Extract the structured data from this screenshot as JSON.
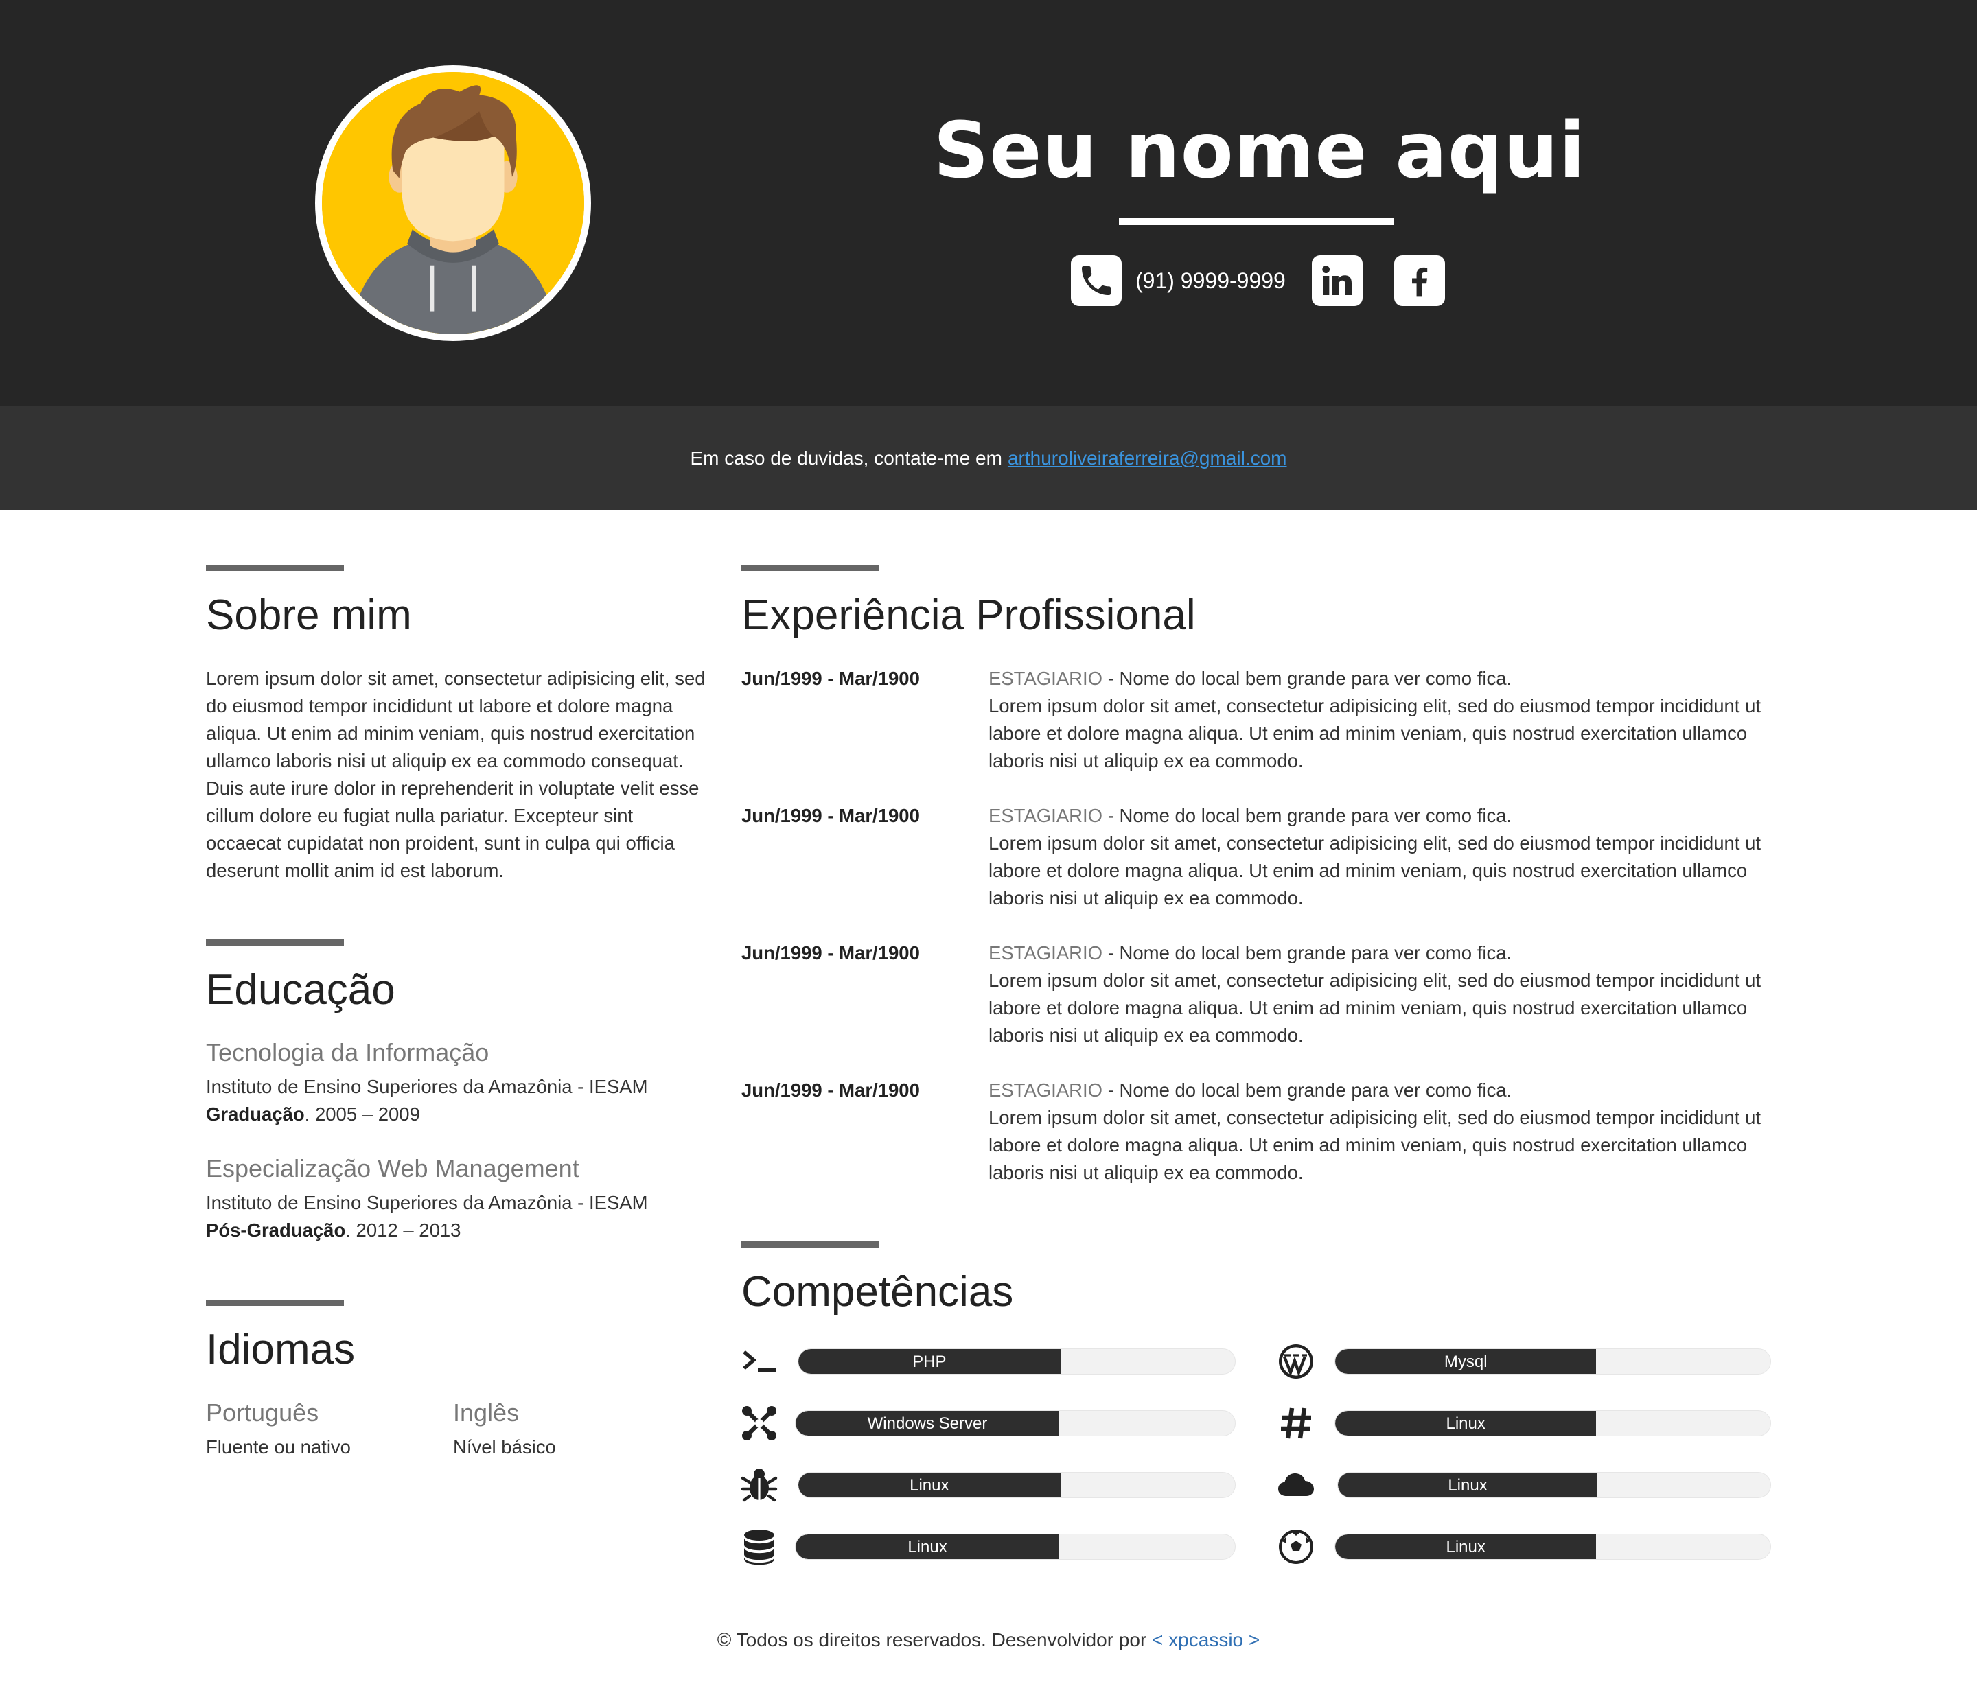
{
  "header": {
    "name": "Seu nome aqui",
    "phone": "(91) 9999-9999",
    "icons": [
      "avatar-illustration",
      "phone-icon",
      "linkedin-icon",
      "facebook-icon"
    ]
  },
  "contact_bar": {
    "text": "Em caso de duvidas, contate-me em",
    "email": "arthuroliveiraferreira@gmail.com"
  },
  "about": {
    "title": "Sobre mim",
    "text": "Lorem ipsum dolor sit amet, consectetur adipisicing elit, sed do eiusmod tempor incididunt ut labore et dolore magna aliqua. Ut enim ad minim veniam, quis nostrud exercitation ullamco laboris nisi ut aliquip ex ea commodo consequat. Duis aute irure dolor in reprehenderit in voluptate velit esse cillum dolore eu fugiat nulla pariatur. Excepteur sint occaecat cupidatat non proident, sunt in culpa qui officia deserunt mollit anim id est laborum."
  },
  "education": {
    "title": "Educação",
    "items": [
      {
        "course": "Tecnologia da Informação",
        "institution": "Instituto de Ensino Superiores da Amazônia - IESAM",
        "level": "Graduação",
        "period": ". 2005 – 2009"
      },
      {
        "course": "Especialização Web Management",
        "institution": "Instituto de Ensino Superiores da Amazônia - IESAM",
        "level": "Pós-Graduação",
        "period": ". 2012 – 2013"
      }
    ]
  },
  "languages": {
    "title": "Idiomas",
    "items": [
      {
        "name": "Português",
        "level": "Fluente ou nativo"
      },
      {
        "name": "Inglês",
        "level": "Nível básico"
      }
    ]
  },
  "experience": {
    "title": "Experiência Profissional",
    "items": [
      {
        "date": "Jun/1999 - Mar/1900",
        "role": "ESTAGIARIO",
        "place": " - Nome do local bem grande para ver como fica.",
        "desc": "Lorem ipsum dolor sit amet, consectetur adipisicing elit, sed do eiusmod tempor incididunt ut labore et dolore magna aliqua. Ut enim ad minim veniam, quis nostrud exercitation ullamco laboris nisi ut aliquip ex ea commodo."
      },
      {
        "date": "Jun/1999 - Mar/1900",
        "role": "ESTAGIARIO",
        "place": " - Nome do local bem grande para ver como fica.",
        "desc": "Lorem ipsum dolor sit amet, consectetur adipisicing elit, sed do eiusmod tempor incididunt ut labore et dolore magna aliqua. Ut enim ad minim veniam, quis nostrud exercitation ullamco laboris nisi ut aliquip ex ea commodo."
      },
      {
        "date": "Jun/1999 - Mar/1900",
        "role": "ESTAGIARIO",
        "place": " - Nome do local bem grande para ver como fica.",
        "desc": "Lorem ipsum dolor sit amet, consectetur adipisicing elit, sed do eiusmod tempor incididunt ut labore et dolore magna aliqua. Ut enim ad minim veniam, quis nostrud exercitation ullamco laboris nisi ut aliquip ex ea commodo."
      },
      {
        "date": "Jun/1999 - Mar/1900",
        "role": "ESTAGIARIO",
        "place": " - Nome do local bem grande para ver como fica.",
        "desc": "Lorem ipsum dolor sit amet, consectetur adipisicing elit, sed do eiusmod tempor incididunt ut labore et dolore magna aliqua. Ut enim ad minim veniam, quis nostrud exercitation ullamco laboris nisi ut aliquip ex ea commodo."
      }
    ]
  },
  "skills": {
    "title": "Competências",
    "items": [
      {
        "label": "PHP",
        "icon": "terminal-icon",
        "level": 0.6
      },
      {
        "label": "Mysql",
        "icon": "wordpress-icon",
        "level": 0.6
      },
      {
        "label": "Windows Server",
        "icon": "joomla-icon",
        "level": 0.6
      },
      {
        "label": "Linux",
        "icon": "hashtag-icon",
        "level": 0.6
      },
      {
        "label": "Linux",
        "icon": "bug-icon",
        "level": 0.6
      },
      {
        "label": "Linux",
        "icon": "cloud-icon",
        "level": 0.6
      },
      {
        "label": "Linux",
        "icon": "database-icon",
        "level": 0.6
      },
      {
        "label": "Linux",
        "icon": "soccer-ball-icon",
        "level": 0.6
      }
    ]
  },
  "footer": {
    "text": "© Todos os direitos reservados. Desenvolvidor por",
    "link": "< xpcassio >"
  }
}
